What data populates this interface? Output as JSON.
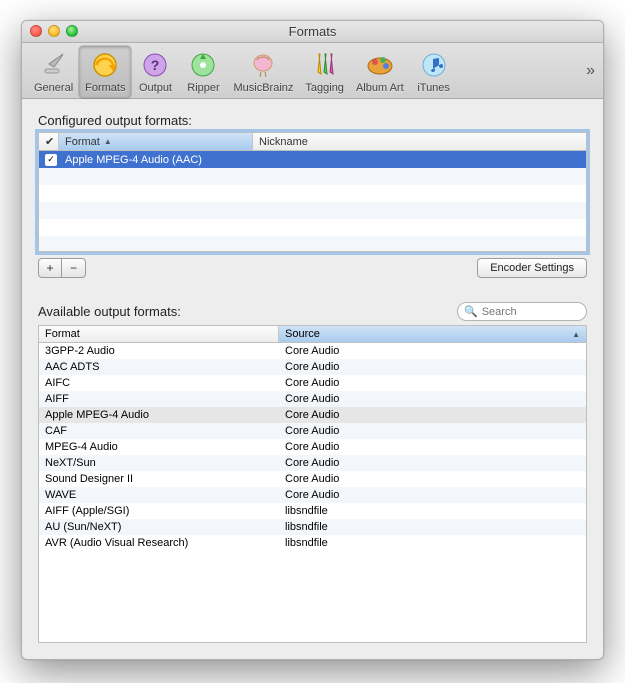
{
  "window": {
    "title": "Formats"
  },
  "toolbar": {
    "items": [
      {
        "label": "General",
        "icon": "general"
      },
      {
        "label": "Formats",
        "icon": "formats"
      },
      {
        "label": "Output",
        "icon": "output"
      },
      {
        "label": "Ripper",
        "icon": "ripper"
      },
      {
        "label": "MusicBrainz",
        "icon": "musicbrainz"
      },
      {
        "label": "Tagging",
        "icon": "tagging"
      },
      {
        "label": "Album Art",
        "icon": "albumart"
      },
      {
        "label": "iTunes",
        "icon": "itunes"
      }
    ],
    "active_index": 1
  },
  "configured": {
    "label": "Configured output formats:",
    "columns": {
      "check": "✔",
      "format": "Format",
      "nickname": "Nickname"
    },
    "rows": [
      {
        "checked": true,
        "format": "Apple MPEG-4 Audio (AAC)",
        "nickname": "",
        "selected": true
      }
    ],
    "blank_rows": 6,
    "add_label": "+",
    "remove_label": "−",
    "encoder_button": "Encoder Settings"
  },
  "available": {
    "label": "Available output formats:",
    "search_placeholder": "Search",
    "columns": {
      "format": "Format",
      "source": "Source"
    },
    "rows": [
      {
        "format": "3GPP-2 Audio",
        "source": "Core Audio"
      },
      {
        "format": "AAC ADTS",
        "source": "Core Audio"
      },
      {
        "format": "AIFC",
        "source": "Core Audio"
      },
      {
        "format": "AIFF",
        "source": "Core Audio"
      },
      {
        "format": "Apple MPEG-4 Audio",
        "source": "Core Audio",
        "highlight": true
      },
      {
        "format": "CAF",
        "source": "Core Audio"
      },
      {
        "format": "MPEG-4 Audio",
        "source": "Core Audio"
      },
      {
        "format": "NeXT/Sun",
        "source": "Core Audio"
      },
      {
        "format": "Sound Designer II",
        "source": "Core Audio"
      },
      {
        "format": "WAVE",
        "source": "Core Audio"
      },
      {
        "format": "AIFF (Apple/SGI)",
        "source": "libsndfile"
      },
      {
        "format": "AU (Sun/NeXT)",
        "source": "libsndfile"
      },
      {
        "format": "AVR (Audio Visual Research)",
        "source": "libsndfile"
      }
    ]
  }
}
